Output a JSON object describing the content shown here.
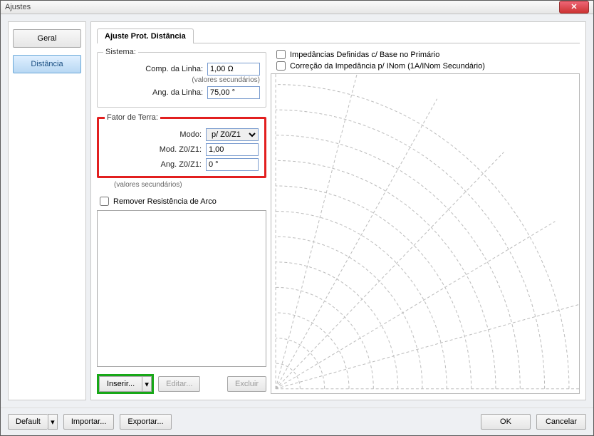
{
  "window": {
    "title": "Ajustes"
  },
  "sidebar": {
    "items": [
      "Geral",
      "Distância"
    ],
    "active_index": 1
  },
  "tab": {
    "label": "Ajuste Prot. Distância"
  },
  "sistema": {
    "legend": "Sistema:",
    "comp_label": "Comp. da Linha:",
    "comp_value": "1,00 Ω",
    "hint": "(valores secundários)",
    "ang_label": "Ang. da Linha:",
    "ang_value": "75,00 °"
  },
  "terra": {
    "legend": "Fator de Terra:",
    "modo_label": "Modo:",
    "modo_value": "p/ Z0/Z1",
    "mod_label": "Mod. Z0/Z1:",
    "mod_value": "1,00",
    "ang_label": "Ang. Z0/Z1:",
    "ang_value": "0 °",
    "hint": "(valores secundários)",
    "remover_label": "Remover Resistência de Arco"
  },
  "right_checks": {
    "prim": "Impedâncias Definidas c/ Base no Primário",
    "inom": "Correção da Impedância p/ INom (1A/INom Secundário)"
  },
  "left_buttons": {
    "inserir": "Inserir...",
    "editar": "Editar...",
    "excluir": "Excluir"
  },
  "footer": {
    "default": "Default",
    "importar": "Importar...",
    "exportar": "Exportar...",
    "ok": "OK",
    "cancelar": "Cancelar"
  },
  "chart_data": {
    "type": "line",
    "title": "",
    "xlabel": "",
    "ylabel": "",
    "origin": "bottom-left",
    "arcs_radii": [
      1,
      2,
      3,
      4,
      5,
      6,
      7,
      8,
      9,
      10,
      11,
      12
    ],
    "ray_angles_deg": [
      0,
      15,
      30,
      45,
      60,
      75,
      90
    ],
    "style": "dashed-grey",
    "series": []
  }
}
